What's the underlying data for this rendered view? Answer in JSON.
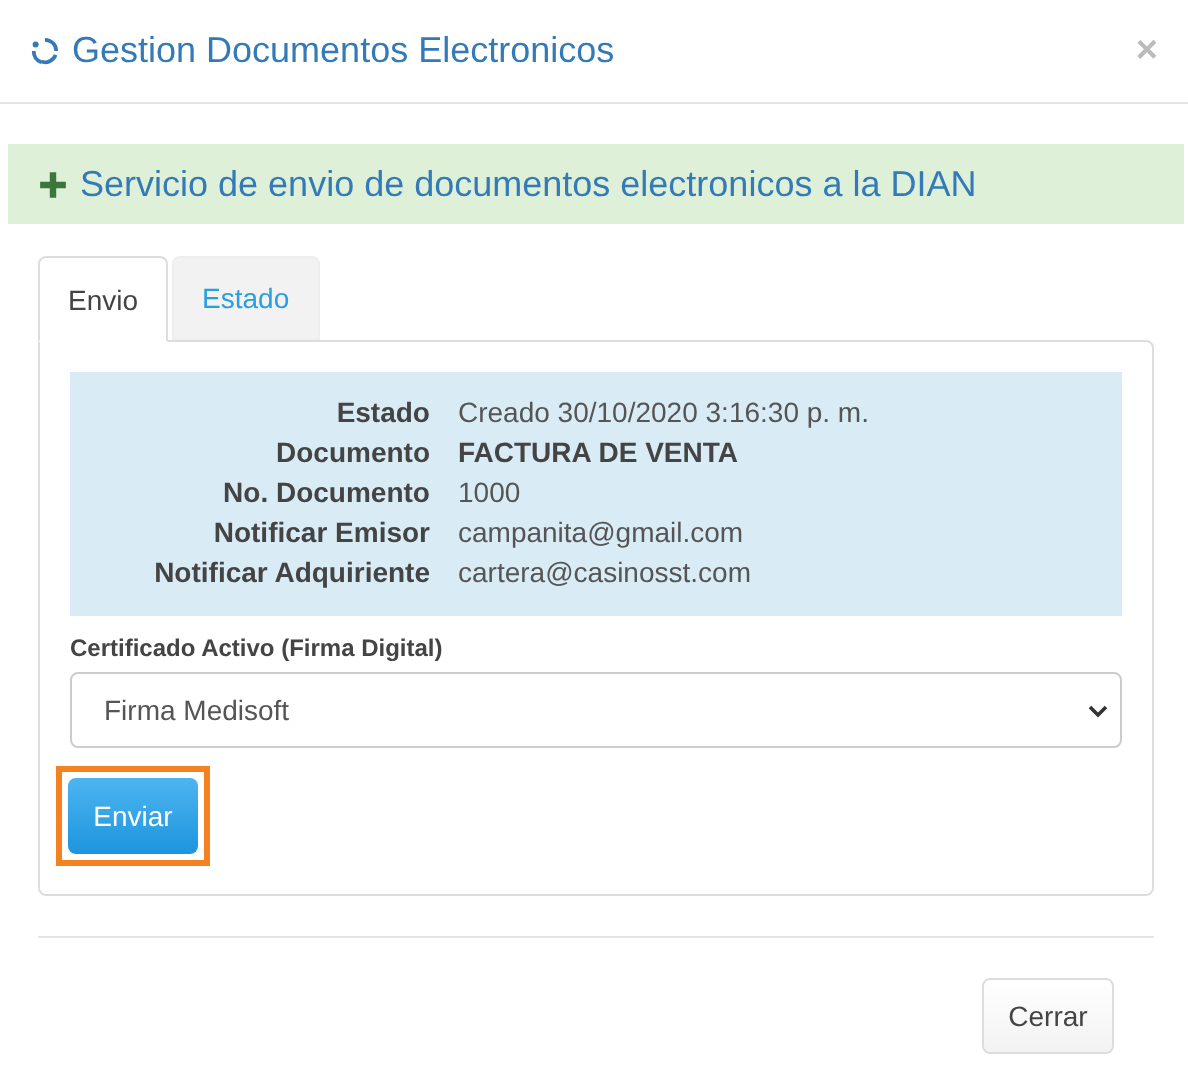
{
  "window": {
    "title": "Gestion Documentos Electronicos",
    "close": "×"
  },
  "banner": {
    "text": "Servicio de envio de documentos electronicos a la DIAN"
  },
  "tabs": [
    {
      "label": "Envio",
      "selected": true
    },
    {
      "label": "Estado",
      "selected": false
    }
  ],
  "info": [
    {
      "label": "Estado",
      "value": "Creado 30/10/2020 3:16:30 p. m.",
      "bold": false
    },
    {
      "label": "Documento",
      "value": "FACTURA DE VENTA",
      "bold": true
    },
    {
      "label": "No. Documento",
      "value": "1000",
      "bold": false
    },
    {
      "label": "Notificar Emisor",
      "value": "campanita@gmail.com",
      "bold": false
    },
    {
      "label": "Notificar Adquiriente",
      "value": "cartera@casinosst.com",
      "bold": false
    }
  ],
  "certificate": {
    "label": "Certificado Activo (Firma Digital)",
    "value": "Firma Medisoft"
  },
  "send_button": {
    "label": "Enviar",
    "highlighted": true
  },
  "close_button": {
    "label": "Cerrar"
  }
}
